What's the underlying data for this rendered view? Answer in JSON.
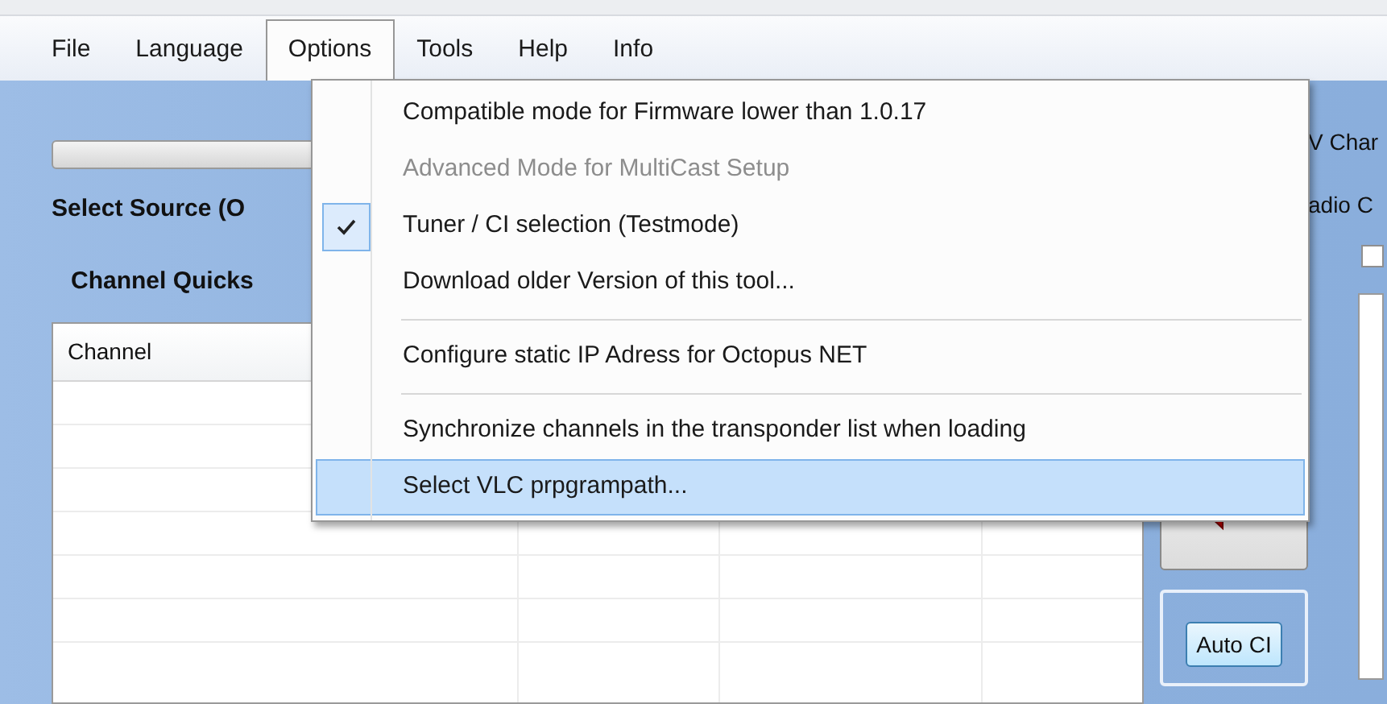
{
  "menu_bar": [
    {
      "label": "File",
      "selected": false
    },
    {
      "label": "Language",
      "selected": false
    },
    {
      "label": "Options",
      "selected": true
    },
    {
      "label": "Tools",
      "selected": false
    },
    {
      "label": "Help",
      "selected": false
    },
    {
      "label": "Info",
      "selected": false
    }
  ],
  "options_menu": [
    {
      "kind": "item",
      "label": "Compatible mode for Firmware lower than 1.0.17",
      "disabled": false,
      "checked": false,
      "selected": false
    },
    {
      "kind": "item",
      "label": "Advanced Mode for MultiCast Setup",
      "disabled": true,
      "checked": false,
      "selected": false
    },
    {
      "kind": "item",
      "label": "Tuner / CI  selection (Testmode)",
      "disabled": false,
      "checked": true,
      "selected": false
    },
    {
      "kind": "item",
      "label": "Download older Version of this tool...",
      "disabled": false,
      "checked": false,
      "selected": false
    },
    {
      "kind": "separator"
    },
    {
      "kind": "item",
      "label": "Configure static IP Adress for Octopus NET",
      "disabled": false,
      "checked": false,
      "selected": false
    },
    {
      "kind": "separator"
    },
    {
      "kind": "item",
      "label": "Synchronize channels in the transponder list when loading",
      "disabled": false,
      "checked": false,
      "selected": false
    },
    {
      "kind": "item",
      "label": "Select VLC prpgrampath...",
      "disabled": false,
      "checked": false,
      "selected": true
    }
  ],
  "select_source_label": "Select Source (O",
  "channel_quickselect_label": "Channel Quicks",
  "table": {
    "columns": [
      "Channel"
    ]
  },
  "right_labels": [
    "V Char",
    "adio C"
  ],
  "auto_ci_button": "Auto CI",
  "checkbox": {
    "checked": false
  }
}
